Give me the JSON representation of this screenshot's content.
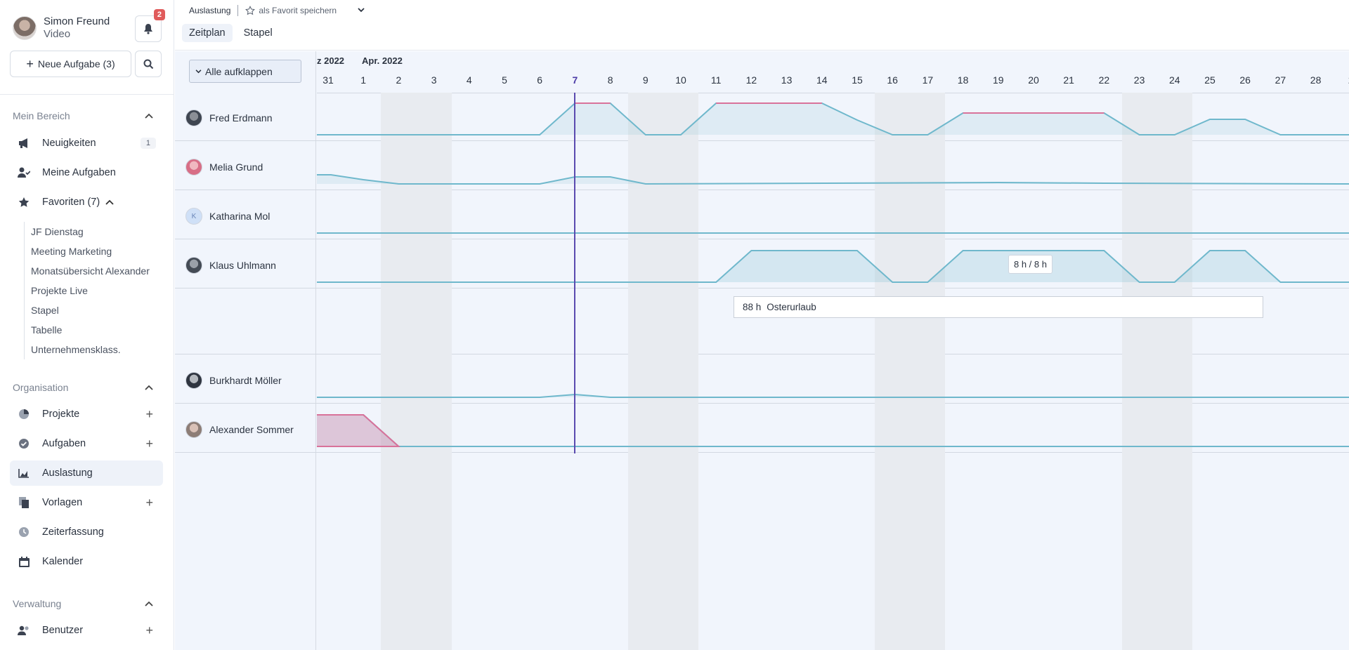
{
  "user": {
    "name": "Simon Freund",
    "sub": "Video",
    "notifications": "2"
  },
  "actions": {
    "new_task": "Neue Aufgabe (3)"
  },
  "sidebar": {
    "section1": "Mein Bereich",
    "items1": [
      {
        "label": "Neuigkeiten",
        "count": "1"
      },
      {
        "label": "Meine Aufgaben"
      },
      {
        "label": "Favoriten (7)"
      }
    ],
    "favorites": [
      "JF Dienstag",
      "Meeting Marketing",
      "Monatsübersicht Alexander",
      "Projekte Live",
      "Stapel",
      "Tabelle",
      "Unternehmensklass."
    ],
    "section2": "Organisation",
    "items2": [
      {
        "label": "Projekte"
      },
      {
        "label": "Aufgaben"
      },
      {
        "label": "Auslastung"
      },
      {
        "label": "Vorlagen"
      },
      {
        "label": "Zeiterfassung"
      },
      {
        "label": "Kalender"
      }
    ],
    "section3": "Verwaltung",
    "items3": [
      {
        "label": "Benutzer"
      }
    ]
  },
  "topbar": {
    "breadcrumb": "Auslastung",
    "favorite": "als Favorit speichern",
    "tabs": [
      "Zeitplan",
      "Stapel"
    ]
  },
  "grid": {
    "expand_all": "Alle aufklappen",
    "months": [
      "z 2022",
      "Apr. 2022"
    ],
    "days": [
      "31",
      "1",
      "2",
      "3",
      "4",
      "5",
      "6",
      "7",
      "8",
      "9",
      "10",
      "11",
      "12",
      "13",
      "14",
      "15",
      "16",
      "17",
      "18",
      "19",
      "20",
      "21",
      "22",
      "23",
      "24",
      "25",
      "26",
      "27",
      "28",
      "2"
    ],
    "today": "7",
    "resources": [
      {
        "name": "Fred Erdmann"
      },
      {
        "name": "Melia Grund"
      },
      {
        "name": "Katharina Mol",
        "initial": "K"
      },
      {
        "name": "Klaus Uhlmann"
      },
      {
        "name": "Burkhardt Möller"
      },
      {
        "name": "Alexander Sommer"
      }
    ],
    "tooltip": "8 h / 8 h",
    "vacation": {
      "hours": "88 h",
      "label": "Osterurlaub"
    }
  },
  "colors": {
    "overload": "#d9729a",
    "capacity": "#6fb8cc",
    "today": "#5a4aaf",
    "accent": "#eef2f9"
  }
}
